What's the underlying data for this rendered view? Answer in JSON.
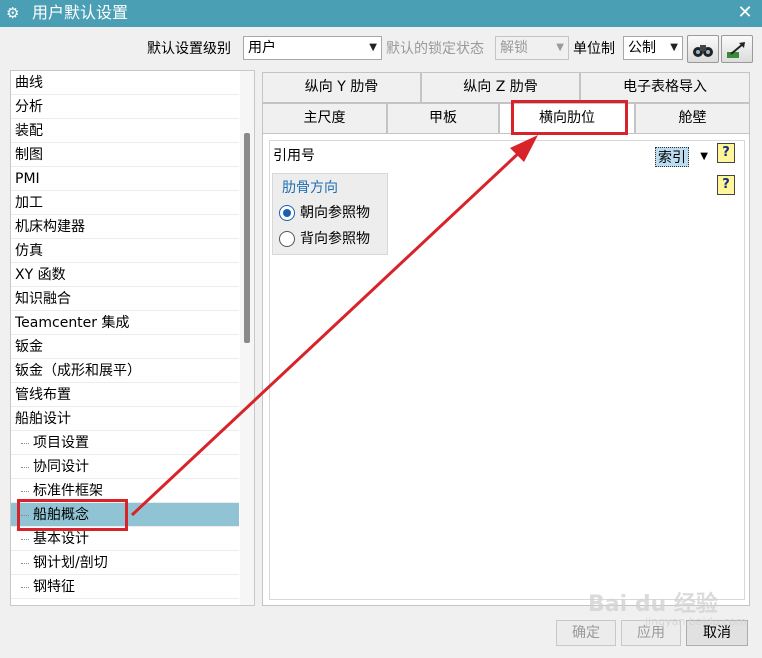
{
  "window": {
    "title": "用户默认设置",
    "title_icon": "⚙",
    "close_glyph": "✕"
  },
  "toolbar": {
    "level_label": "默认设置级别",
    "level_value": "用户",
    "lock_label": "默认的锁定状态",
    "lock_value": "解锁",
    "unit_label": "单位制",
    "unit_value": "公制",
    "dropdown_arrow": "▼",
    "icon1_glyph": "◉◉",
    "icon2_glyph": "➹"
  },
  "tree": {
    "items": [
      {
        "label": "曲线"
      },
      {
        "label": "分析"
      },
      {
        "label": "装配"
      },
      {
        "label": "制图"
      },
      {
        "label": "PMI"
      },
      {
        "label": "加工"
      },
      {
        "label": "机床构建器"
      },
      {
        "label": "仿真"
      },
      {
        "label": "XY 函数"
      },
      {
        "label": "知识融合"
      },
      {
        "label": "Teamcenter 集成"
      },
      {
        "label": "钣金"
      },
      {
        "label": "钣金（成形和展平）"
      },
      {
        "label": "管线布置"
      },
      {
        "label": "船舶设计"
      }
    ],
    "children": [
      {
        "label": "项目设置"
      },
      {
        "label": "协同设计"
      },
      {
        "label": "标准件框架"
      },
      {
        "label": "船舶概念"
      },
      {
        "label": "基本设计"
      },
      {
        "label": "钢计划/剖切"
      },
      {
        "label": "钢特征"
      }
    ],
    "selected_child": "船舶概念"
  },
  "tabs": {
    "row1": [
      {
        "label": "纵向 Y 肋骨"
      },
      {
        "label": "纵向 Z 肋骨"
      },
      {
        "label": "电子表格导入"
      }
    ],
    "row2": [
      {
        "label": "主尺度"
      },
      {
        "label": "甲板"
      },
      {
        "label": "横向肋位"
      },
      {
        "label": "舱壁"
      }
    ],
    "active": "横向肋位"
  },
  "content": {
    "ref_label": "引用号",
    "index_value": "索引",
    "help_glyph": "?",
    "group_title": "肋骨方向",
    "radio_options": [
      {
        "label": "朝向参照物",
        "checked": true
      },
      {
        "label": "背向参照物",
        "checked": false
      }
    ]
  },
  "buttons": {
    "ok": "确定",
    "apply": "应用",
    "cancel": "取消"
  },
  "watermark": {
    "text": "Bai du 经验",
    "sub": "jingyan.baidu.com"
  },
  "colors": {
    "titlebar": "#4a9fb5",
    "selection": "#90c4d4",
    "annotation_red": "#d8232a",
    "group_title": "#1f6fb2"
  }
}
